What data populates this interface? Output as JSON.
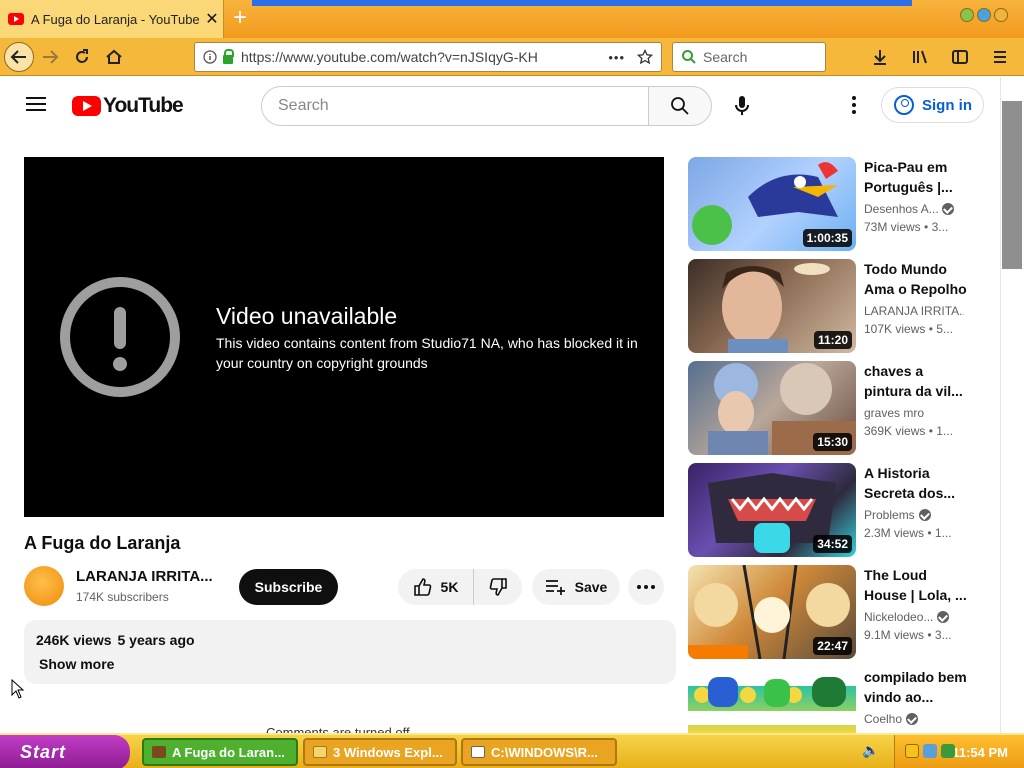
{
  "browser": {
    "tab_title": "A Fuga do Laranja - YouTube",
    "tab_close": "✕",
    "new_tab": "+",
    "url": "https://www.youtube.com/watch?v=nJSIqyG-KH",
    "url_more": "•••",
    "search_placeholder": "Search"
  },
  "header": {
    "logo_text": "YouTube",
    "search_placeholder": "Search",
    "signin_label": "Sign in"
  },
  "player": {
    "error_title": "Video unavailable",
    "error_message": "This video contains content from Studio71 NA, who has blocked it in your country on copyright grounds"
  },
  "video": {
    "title": "A Fuga do Laranja",
    "channel_name": "LARANJA IRRITA...",
    "subscribers": "174K subscribers",
    "subscribe_label": "Subscribe",
    "likes": "5K",
    "save_label": "Save",
    "views": "246K views",
    "age": "5 years ago",
    "show_more": "Show more",
    "comments_partial": "Comments are turned off"
  },
  "recommendations": [
    {
      "title": "Pica-Pau em Português |...",
      "channel": "Desenhos A...",
      "verified": true,
      "views": "73M views",
      "age": "• 3...",
      "duration": "1:00:35"
    },
    {
      "title": "Todo Mundo Ama o Repolho",
      "channel": "LARANJA IRRITA...",
      "verified": false,
      "views": "107K views",
      "age": "• 5...",
      "duration": "11:20"
    },
    {
      "title": "chaves a pintura da vil...",
      "channel": "graves mro",
      "verified": false,
      "views": "369K views",
      "age": "• 1...",
      "duration": "15:30"
    },
    {
      "title": "A Historia Secreta dos...",
      "channel": "Problems",
      "verified": true,
      "views": "2.3M views",
      "age": "• 1...",
      "duration": "34:52"
    },
    {
      "title": "The Loud House | Lola, ...",
      "channel": "Nickelodeo...",
      "verified": true,
      "views": "9.1M views",
      "age": "• 3...",
      "duration": "22:47"
    },
    {
      "title": "compilado bem vindo ao...",
      "channel": "Coelho",
      "verified": true,
      "views": "",
      "age": "",
      "duration": ""
    }
  ],
  "taskbar": {
    "start_label": "Start",
    "tasks": [
      "A Fuga do Laran...",
      "3 Windows Expl...",
      "C:\\WINDOWS\\R..."
    ],
    "clock": "11:54 PM"
  },
  "colors": {
    "youtube_red": "#ff0000",
    "link_blue": "#065fd4",
    "browser_chrome": "#f5b83b",
    "taskbar_start": "#8d1b91"
  }
}
